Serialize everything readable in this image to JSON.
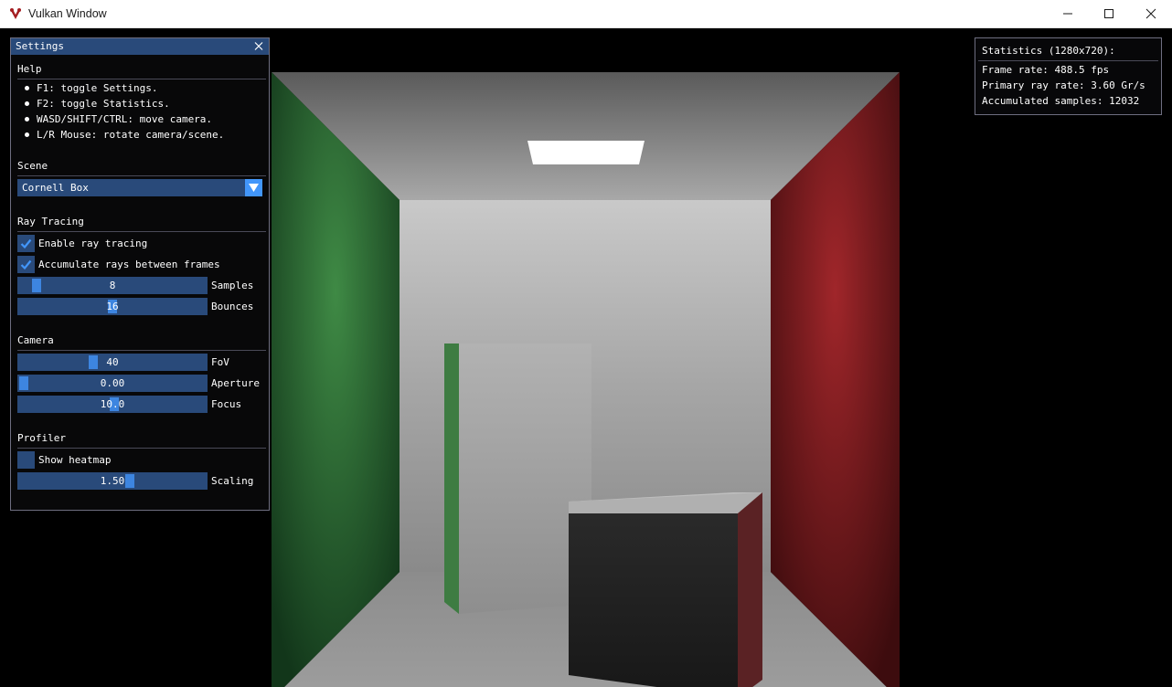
{
  "window": {
    "title": "Vulkan Window",
    "icon": "vulkan-logo-icon",
    "controls": [
      "minimize-icon",
      "maximize-icon",
      "close-icon"
    ]
  },
  "settings": {
    "title": "Settings",
    "help": {
      "heading": "Help",
      "items": [
        "F1: toggle Settings.",
        "F2: toggle Statistics.",
        "WASD/SHIFT/CTRL: move camera.",
        "L/R Mouse: rotate camera/scene."
      ]
    },
    "scene": {
      "heading": "Scene",
      "selected": "Cornell Box"
    },
    "ray_tracing": {
      "heading": "Ray Tracing",
      "enable_label": "Enable ray tracing",
      "enable_checked": true,
      "accumulate_label": "Accumulate rays between frames",
      "accumulate_checked": true,
      "samples_value": "8",
      "samples_fraction": 0.07,
      "samples_label": "Samples",
      "bounces_value": "16",
      "bounces_fraction": 0.5,
      "bounces_label": "Bounces"
    },
    "camera": {
      "heading": "Camera",
      "fov_value": "40",
      "fov_fraction": 0.39,
      "fov_label": "FoV",
      "aperture_value": "0.00",
      "aperture_fraction": 0.0,
      "aperture_label": "Aperture",
      "focus_value": "10.0",
      "focus_fraction": 0.51,
      "focus_label": "Focus"
    },
    "profiler": {
      "heading": "Profiler",
      "heatmap_label": "Show heatmap",
      "heatmap_checked": false,
      "scaling_value": "1.50",
      "scaling_fraction": 0.6,
      "scaling_label": "Scaling"
    }
  },
  "statistics": {
    "title": "Statistics (1280x720):",
    "frame_rate": "Frame rate: 488.5 fps",
    "ray_rate": "Primary ray rate: 3.60 Gr/s",
    "samples": "Accumulated samples:  12032"
  },
  "colors": {
    "panel_bg": "#08080a",
    "title_bg": "#294a7a",
    "frame_bg": "#294a7a",
    "accent": "#4296fa",
    "wall_left": "#3f8a45",
    "wall_right": "#a0262a",
    "wall_white": "#c8c8c8"
  }
}
